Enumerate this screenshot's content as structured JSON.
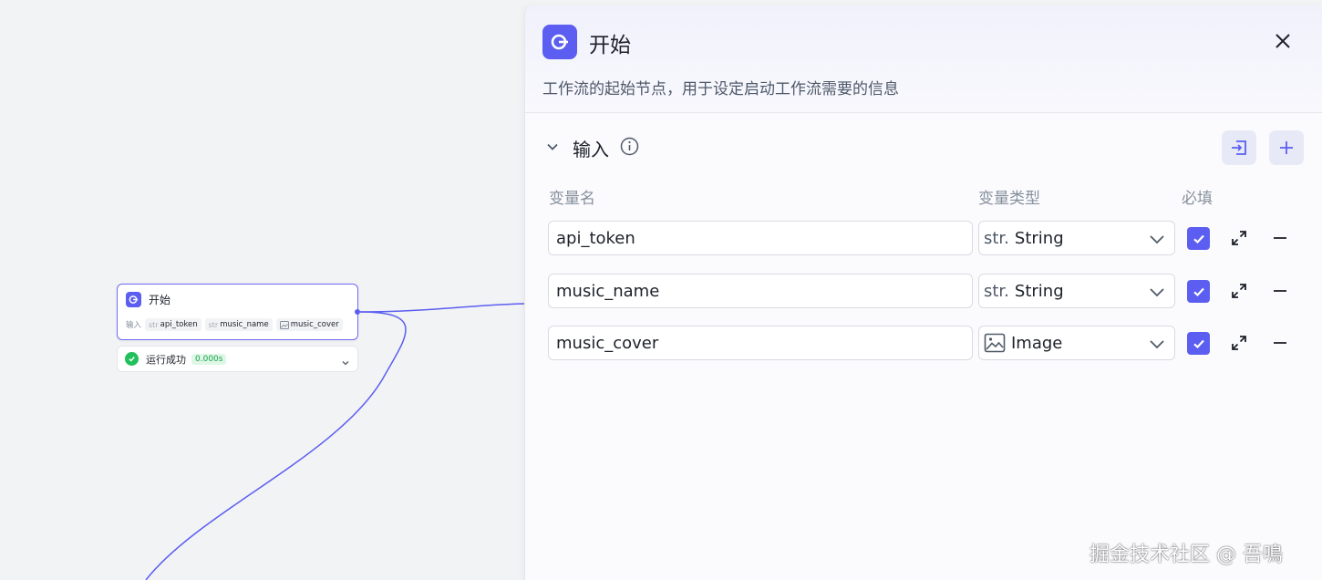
{
  "canvas": {
    "node": {
      "title": "开始",
      "io_label": "输入",
      "inputs": [
        {
          "type_prefix": "str",
          "name": "api_token"
        },
        {
          "type_prefix": "str",
          "name": "music_name"
        },
        {
          "type_prefix": "image-icon",
          "name": "music_cover"
        }
      ]
    },
    "status": {
      "text": "运行成功",
      "time": "0.000s"
    }
  },
  "panel": {
    "title": "开始",
    "description": "工作流的起始节点，用于设定启动工作流需要的信息",
    "section_title": "输入",
    "columns": {
      "name": "变量名",
      "type": "变量类型",
      "required": "必填"
    },
    "rows": [
      {
        "name": "api_token",
        "type_prefix": "str.",
        "type_label": "String",
        "required": true
      },
      {
        "name": "music_name",
        "type_prefix": "str.",
        "type_label": "String",
        "required": true
      },
      {
        "name": "music_cover",
        "type_prefix": "image-icon",
        "type_label": "Image",
        "required": true
      }
    ]
  },
  "watermark": "掘金技术社区 @ 吾鳴",
  "colors": {
    "accent": "#5b5ef0",
    "success": "#20c05c",
    "canvas_bg": "#f2f3f5"
  }
}
